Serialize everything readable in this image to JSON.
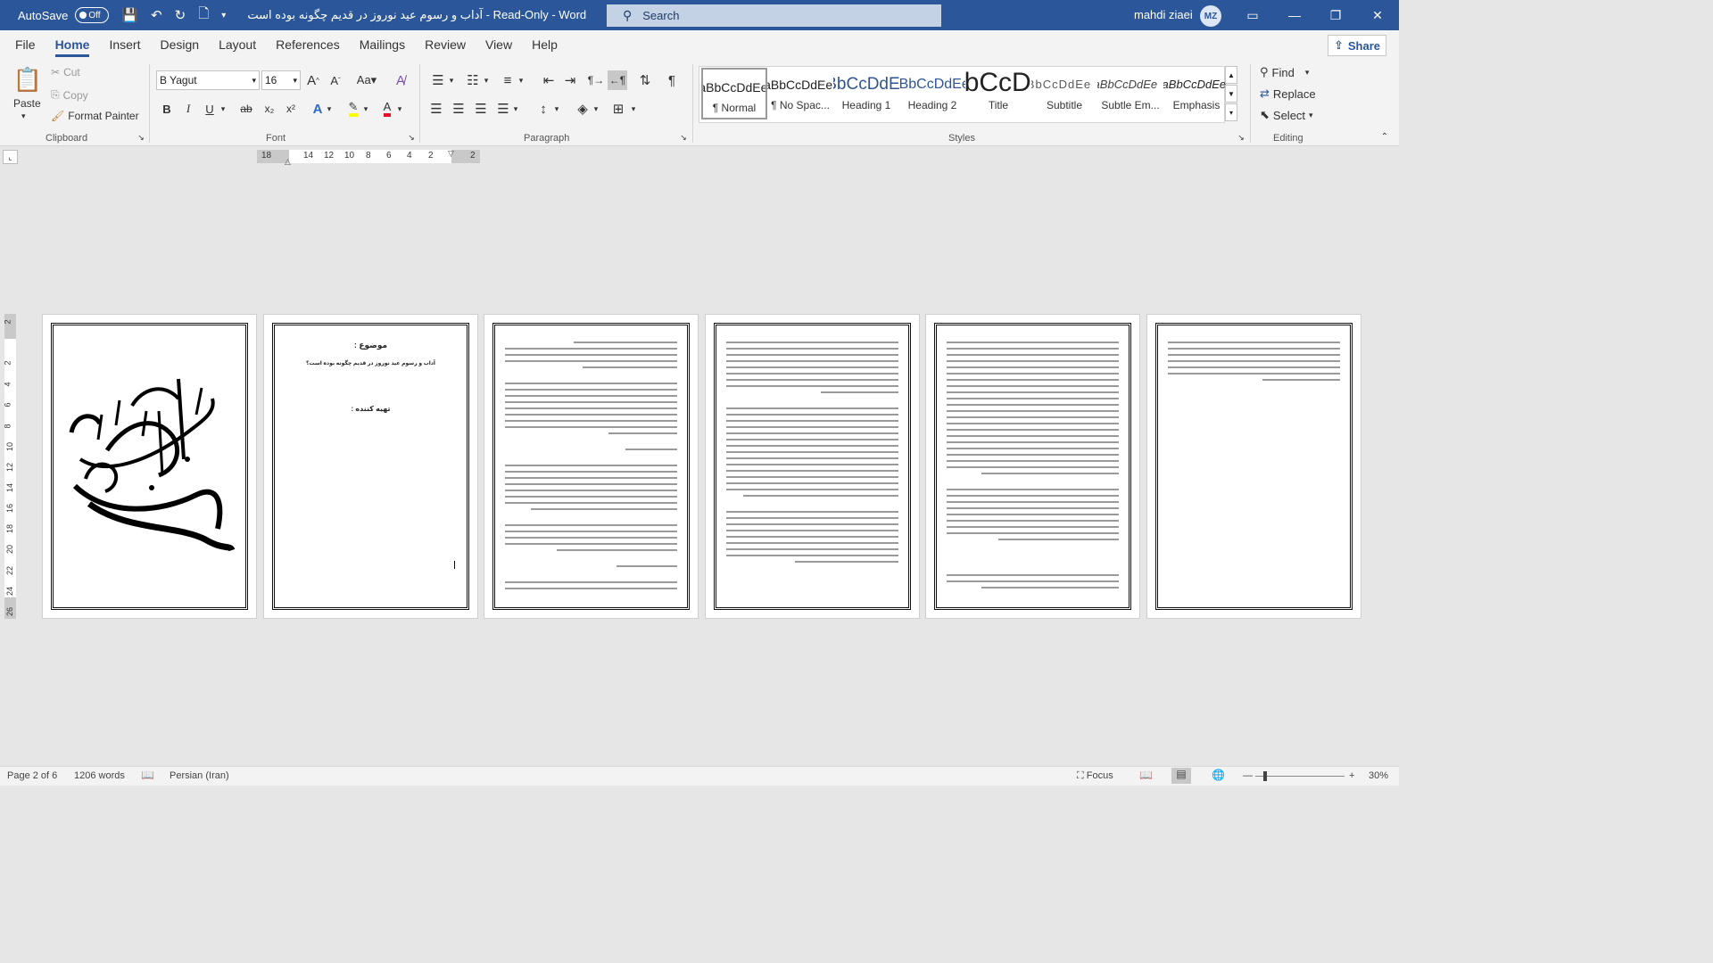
{
  "titlebar": {
    "autosave_label": "AutoSave",
    "autosave_state": "Off",
    "document_title": "آداب و رسوم عید نوروز در قدیم چگونه بوده است  -  Read-Only  -  Word",
    "search_placeholder": "Search",
    "user_name": "mahdi ziaei",
    "user_initials": "MZ"
  },
  "menu": {
    "tabs": [
      "File",
      "Home",
      "Insert",
      "Design",
      "Layout",
      "References",
      "Mailings",
      "Review",
      "View",
      "Help"
    ],
    "active_tab": "Home",
    "share_label": "Share"
  },
  "ribbon": {
    "clipboard": {
      "paste": "Paste",
      "cut": "Cut",
      "copy": "Copy",
      "format_painter": "Format Painter",
      "label": "Clipboard"
    },
    "font": {
      "name": "B Yagut",
      "size": "16",
      "label": "Font",
      "highlight_color": "#ffff00",
      "font_color": "#e81123"
    },
    "paragraph": {
      "label": "Paragraph"
    },
    "styles": {
      "label": "Styles",
      "items": [
        {
          "preview": "AaBbCcDdEe",
          "name": "¶ Normal"
        },
        {
          "preview": "AaBbCcDdEe",
          "name": "¶ No Spac..."
        },
        {
          "preview": "AaBbCcDdEe",
          "name": "Heading 1"
        },
        {
          "preview": "AaBbCcDdEe",
          "name": "Heading 2"
        },
        {
          "preview": "AaBbCcDdEe",
          "name": "Title"
        },
        {
          "preview": "AaBbCcDdEe",
          "name": "Subtitle"
        },
        {
          "preview": "AaBbCcDdEe",
          "name": "Subtle Em..."
        },
        {
          "preview": "AaBbCcDdEe",
          "name": "Emphasis"
        }
      ]
    },
    "editing": {
      "find": "Find",
      "replace": "Replace",
      "select": "Select",
      "label": "Editing"
    }
  },
  "ruler": {
    "horizontal": [
      "18",
      "14",
      "12",
      "10",
      "8",
      "6",
      "4",
      "2",
      "2"
    ],
    "vertical": [
      "2",
      "2",
      "4",
      "6",
      "8",
      "10",
      "12",
      "14",
      "16",
      "18",
      "20",
      "22",
      "24",
      "26"
    ]
  },
  "pages": {
    "page2": {
      "subject_label": "موضوع :",
      "subject": "آداب و رسوم عید نوروز در قدیم چگونه بوده است؟",
      "author_label": "تهیه کننده :"
    }
  },
  "statusbar": {
    "page": "Page 2 of 6",
    "words": "1206 words",
    "language": "Persian (Iran)",
    "focus": "Focus",
    "zoom": "30%"
  },
  "colors": {
    "accent": "#2b579a"
  }
}
